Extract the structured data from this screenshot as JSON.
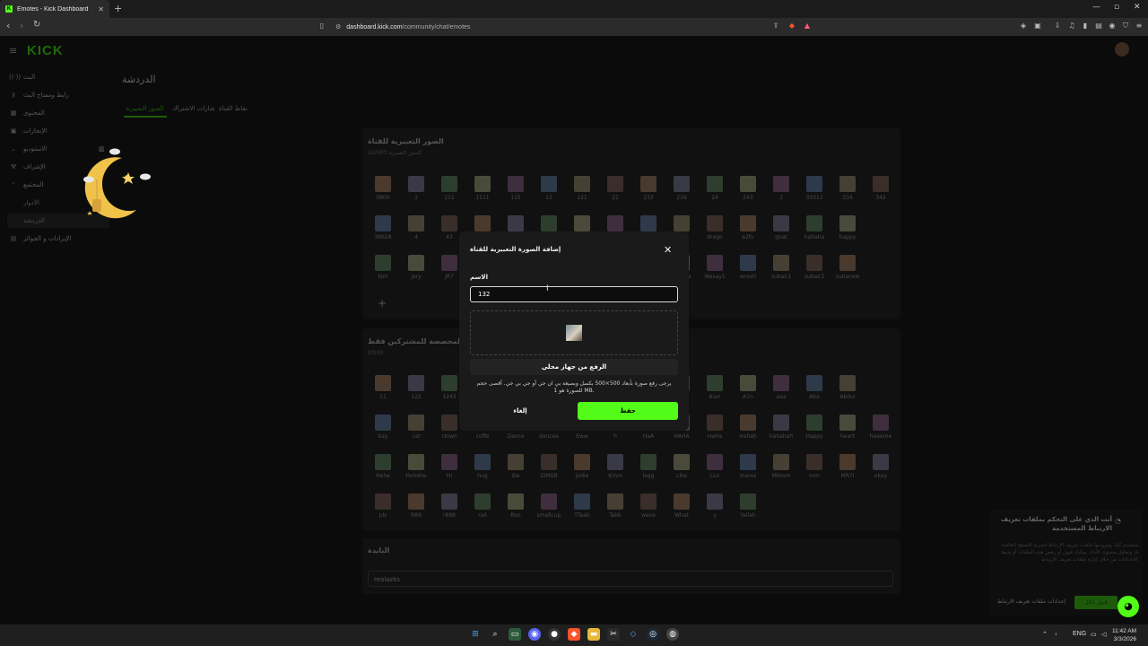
{
  "browser": {
    "tab_title": "Emotes - Kick Dashboard",
    "url_host": "dashboard.kick.com",
    "url_path": "/community/chat/emotes"
  },
  "site": {
    "logo": "KICK"
  },
  "sidebar": {
    "items": [
      {
        "label": "البث",
        "icon": "broadcast-icon"
      },
      {
        "label": "رابط ومفتاح البث",
        "icon": "key-icon"
      },
      {
        "label": "المحتوى",
        "icon": "content-icon"
      },
      {
        "label": "الإنجازات",
        "icon": "trophy-icon"
      },
      {
        "label": "الاستوديو",
        "icon": "chevron-icon"
      },
      {
        "label": "الإشراف",
        "icon": "moderation-icon"
      },
      {
        "label": "المجتمع",
        "icon": "chevron-icon"
      }
    ],
    "sub_items": [
      "الأدوار",
      "الدردشة"
    ],
    "last_item": {
      "label": "الإيرادات و الجوائز",
      "icon": "revenue-icon"
    }
  },
  "page": {
    "title": "الدردشة",
    "tabs": [
      "الصور التعبيرية",
      "شارات الاشتراك",
      "نقاط القناة"
    ]
  },
  "channel_emotes": {
    "title": "الصور التعبيرية للقناة",
    "subtitle": "32/500 الصور التعبيرية",
    "rows": [
      [
        "0800",
        "1",
        "111",
        "1111",
        "115",
        "12",
        "121",
        "22",
        "233",
        "234",
        "24",
        "243",
        "3",
        "33312",
        "334",
        "342"
      ],
      [
        "39628",
        "4",
        "43",
        "",
        "",
        "",
        "",
        "",
        "",
        "cr7",
        "drago",
        "e2fu",
        "goat",
        "hahaha",
        "happy"
      ],
      [
        "kim",
        "jery",
        "JR7",
        "",
        "",
        "",
        "",
        "",
        "",
        "shesha",
        "Wesay1",
        "wrestl",
        "zubair1",
        "zubair2",
        "zubanew"
      ]
    ]
  },
  "subscriber_emotes": {
    "title": "الصور التعبيرية المخصصة للمشتركين فقط",
    "subtitle": "0/500",
    "rows": [
      [
        "11",
        "122",
        "1243",
        "",
        "",
        "",
        "",
        "",
        "",
        "99",
        "8ian",
        "A7n",
        "aaa",
        "Aba",
        "Abdul"
      ],
      [
        "bay",
        "cat",
        "clown",
        "coffe",
        "Dance",
        "dancee",
        "Eww",
        "h",
        "HaA",
        "HAHA",
        "HaHa",
        "Hahah",
        "hahahah",
        "Happy",
        "heart",
        "heaeme"
      ],
      [
        "Hehe",
        "Hehehe",
        "Hi",
        "hug",
        "ibe",
        "IDMSB",
        "jodie",
        "Kmm",
        "lagg",
        "Like",
        "LLo",
        "mares",
        "Mtoom",
        "mm",
        "MR7I",
        "okay"
      ],
      [
        "pls",
        "R89",
        "r898",
        "rail",
        "Run",
        "smallcup",
        "TTeah",
        "Takk",
        "wave",
        "What",
        "y",
        "Yallah"
      ]
    ]
  },
  "bio": {
    "title": "البايدة",
    "value": "realazks"
  },
  "modal": {
    "title": "إضافة الصورة التعبيرية للقناة",
    "name_label": "الاسم",
    "name_value": "132",
    "upload_label": "الرفع من جهاز محلي",
    "hint": "يرجى رفع صورة بأبعاد 500×500 بكسل وبصيغة بي ان جي أو جي بي جي. أقصى حجم للصورة هو 1 MB.",
    "cancel_label": "إلغاء",
    "save_label": "حفظ"
  },
  "cookie": {
    "title": "أنت الذي على التحكم بملفات تعريف الارتباط المستخدمة",
    "body": "نستخدم كيك ومزوديها ملفات تعريف الارتباط لتجربة التصفح الخاصة بك وتحليل مستوى الأداء. يمكنك قبول أو رفض هذه الملفات أو ضبط الإعدادات من خلال إدارة ملفات تعريف الارتباط.",
    "manage_label": "إعدادات ملفات تعريف الارتباط",
    "accept_label": "قبول الكل"
  },
  "taskbar": {
    "lang": "ENG",
    "time": "11:42 AM",
    "date": "3/3/2026"
  },
  "colors": {
    "accent": "#53fc18",
    "modal_bg": "#1a1a1a"
  }
}
